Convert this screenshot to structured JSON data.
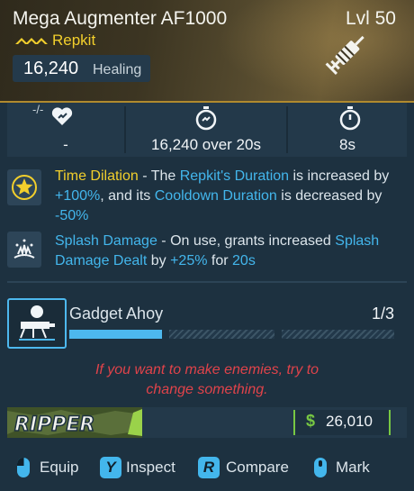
{
  "item": {
    "name": "Mega Augmenter AF1000",
    "level": "Lvl 50",
    "type": "Repkit",
    "stat_value": "16,240",
    "stat_unit": "Healing",
    "rarity_color": "#f2cf2c"
  },
  "stats": [
    {
      "icon": "heart-capacity-icon",
      "label": "-"
    },
    {
      "icon": "duration-timer-icon",
      "label": "16,240 over 20s"
    },
    {
      "icon": "cooldown-stopwatch-icon",
      "label": "8s"
    }
  ],
  "stat_icon_prefix": "-/-",
  "perks": [
    {
      "icon": "star-badge-icon",
      "name": "Time Dilation",
      "t1": " - The ",
      "h1": "Repkit's Duration",
      "t2": " is increased by ",
      "h2": "+100%",
      "t3": ", and its ",
      "h3": "Cooldown Duration",
      "t4": " is decreased by ",
      "h4": "-50%"
    },
    {
      "icon": "splash-burst-icon",
      "name": "Splash Damage",
      "t1": " - On use, grants increased ",
      "h1": "Splash Damage Dealt",
      "t2": " by ",
      "h2": "+25%",
      "t3": " for ",
      "h3": "20s"
    }
  ],
  "challenge": {
    "name": "Gadget Ahoy",
    "count": "1/3",
    "progress": 0.333,
    "icon": "gadget-turret-icon"
  },
  "flavor_line1": "If you want to make enemies, try to",
  "flavor_line2": "change something.",
  "manufacturer": {
    "name": "RIPPER",
    "logo_icon": "ripper-logo"
  },
  "price": {
    "currency": "$",
    "value": "26,010",
    "color": "#77c843"
  },
  "actions": [
    {
      "key": "mouse-left",
      "label": "Equip"
    },
    {
      "key": "Y",
      "label": "Inspect"
    },
    {
      "key": "R",
      "label": "Compare"
    },
    {
      "key": "mouse-middle",
      "label": "Mark"
    }
  ],
  "colors": {
    "accent_blue": "#43b6ec",
    "accent_yellow": "#f2cf2c",
    "flavor_red": "#e0434a"
  }
}
